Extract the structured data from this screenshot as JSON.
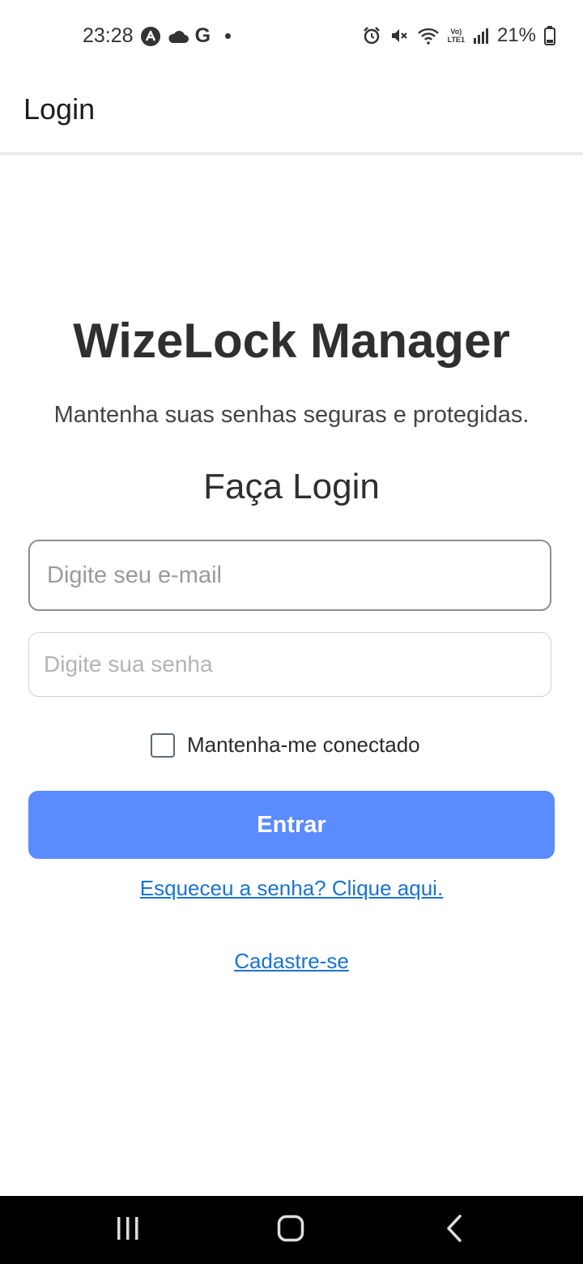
{
  "status_bar": {
    "time": "23:28",
    "battery": "21%",
    "network_label_top": "Vo)",
    "network_label_bottom": "LTE1",
    "icons": [
      "a-circle-icon",
      "cloud-icon",
      "google-g-icon",
      "dot-icon",
      "alarm-icon",
      "mute-icon",
      "wifi-icon",
      "signal-icon",
      "battery-icon"
    ],
    "google_letter": "G"
  },
  "appbar": {
    "title": "Login"
  },
  "main": {
    "app_name": "WizeLock Manager",
    "tagline": "Mantenha suas senhas seguras e protegidas.",
    "heading": "Faça Login",
    "email_placeholder": "Digite seu e-mail",
    "password_placeholder": "Digite sua senha",
    "remember_label": "Mantenha-me conectado",
    "remember_checked": false,
    "login_button": "Entrar",
    "forgot_link": "Esqueceu a senha? Clique aqui.",
    "signup_link": "Cadastre-se"
  },
  "colors": {
    "primary_button": "#5a8bff",
    "link": "#1a73d2",
    "nav_bar": "#000000"
  },
  "nav": {
    "icons": [
      "recents-icon",
      "home-icon",
      "back-icon"
    ]
  }
}
